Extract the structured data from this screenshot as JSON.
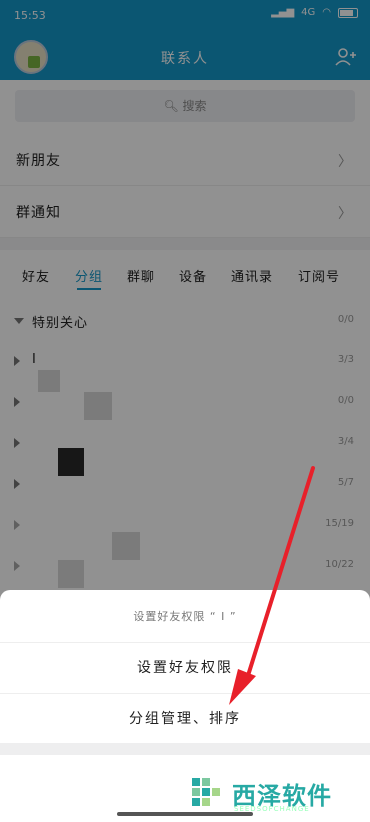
{
  "status_bar": {
    "time": "15:53",
    "network": "4G",
    "battery_icon": "battery-icon"
  },
  "header": {
    "title": "联系人",
    "add_icon": "add-contact-icon"
  },
  "search": {
    "placeholder": "搜索"
  },
  "rows": [
    {
      "label": "新朋友"
    },
    {
      "label": "群通知"
    }
  ],
  "tabs": [
    {
      "label": "好友",
      "active": false
    },
    {
      "label": "分组",
      "active": true
    },
    {
      "label": "群聊",
      "active": false
    },
    {
      "label": "设备",
      "active": false
    },
    {
      "label": "通讯录",
      "active": false
    },
    {
      "label": "订阅号",
      "active": false
    }
  ],
  "groups": [
    {
      "name": "特别关心",
      "count": "0/0",
      "expanded": true
    },
    {
      "name": "I",
      "count": "3/3",
      "expanded": false
    },
    {
      "name": "",
      "count": "0/0",
      "expanded": false
    },
    {
      "name": "",
      "count": "3/4",
      "expanded": false
    },
    {
      "name": "",
      "count": "5/7",
      "expanded": false
    },
    {
      "name": "",
      "count": "15/19",
      "expanded": false
    },
    {
      "name": "",
      "count": "10/22",
      "expanded": false
    }
  ],
  "sheet": {
    "caption": "设置好友权限 “ I ”",
    "option1": "设置好友权限",
    "option2": "分组管理、排序"
  },
  "watermark": {
    "brand": "西泽软件",
    "sub": "SEEDSOFCHANGE"
  },
  "colors": {
    "accent": "#1597c8",
    "arrow": "#e8202a"
  }
}
